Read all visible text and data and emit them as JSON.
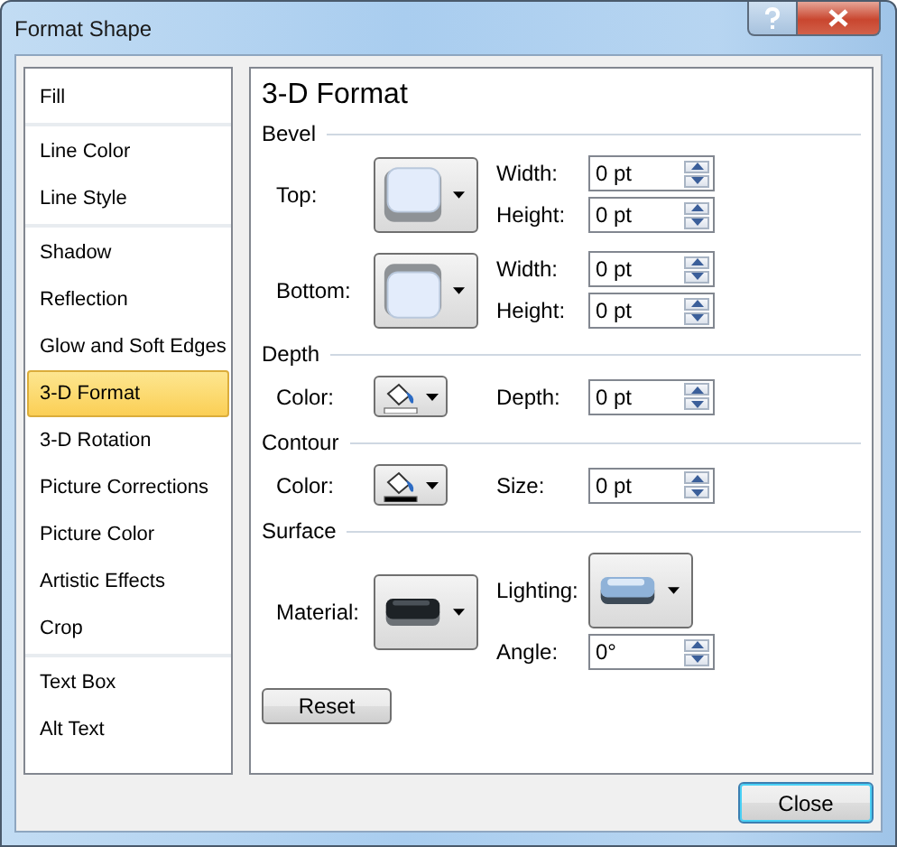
{
  "window": {
    "title": "Format Shape"
  },
  "sidebar": {
    "groups": [
      {
        "items": [
          {
            "label": "Fill",
            "selected": false
          }
        ]
      },
      {
        "items": [
          {
            "label": "Line Color",
            "selected": false
          },
          {
            "label": "Line Style",
            "selected": false
          }
        ]
      },
      {
        "items": [
          {
            "label": "Shadow",
            "selected": false
          },
          {
            "label": "Reflection",
            "selected": false
          },
          {
            "label": "Glow and Soft Edges",
            "selected": false
          },
          {
            "label": "3-D Format",
            "selected": true
          },
          {
            "label": "3-D Rotation",
            "selected": false
          },
          {
            "label": "Picture Corrections",
            "selected": false
          },
          {
            "label": "Picture Color",
            "selected": false
          },
          {
            "label": "Artistic Effects",
            "selected": false
          },
          {
            "label": "Crop",
            "selected": false
          }
        ]
      },
      {
        "items": [
          {
            "label": "Text Box",
            "selected": false
          },
          {
            "label": "Alt Text",
            "selected": false
          }
        ]
      }
    ]
  },
  "panel": {
    "title": "3-D Format",
    "sections": [
      {
        "heading": "Bevel",
        "rows": [
          {
            "label": "Top:",
            "picker": {
              "kind": "bevel_top"
            },
            "fields": [
              {
                "label": "Width:",
                "value": "0 pt"
              },
              {
                "label": "Height:",
                "value": "0 pt"
              }
            ]
          },
          {
            "label": "Bottom:",
            "picker": {
              "kind": "bevel_bottom"
            },
            "fields": [
              {
                "label": "Width:",
                "value": "0 pt"
              },
              {
                "label": "Height:",
                "value": "0 pt"
              }
            ]
          }
        ]
      },
      {
        "heading": "Depth",
        "rows": [
          {
            "label": "Color:",
            "picker": {
              "kind": "color",
              "color": "#ffffff"
            },
            "fields": [
              {
                "label": "Depth:",
                "value": "0 pt"
              }
            ]
          }
        ]
      },
      {
        "heading": "Contour",
        "rows": [
          {
            "label": "Color:",
            "picker": {
              "kind": "color",
              "color": "#000000"
            },
            "fields": [
              {
                "label": "Size:",
                "value": "0 pt"
              }
            ]
          }
        ]
      },
      {
        "heading": "Surface",
        "rows": [
          {
            "label": "Material:",
            "picker": {
              "kind": "material"
            },
            "fields": [
              {
                "label": "Lighting:",
                "picker": {
                  "kind": "lighting"
                }
              },
              {
                "label": "Angle:",
                "value": "0°"
              }
            ]
          }
        ]
      }
    ],
    "reset_button": "Reset"
  },
  "buttons": [
    "Close"
  ]
}
